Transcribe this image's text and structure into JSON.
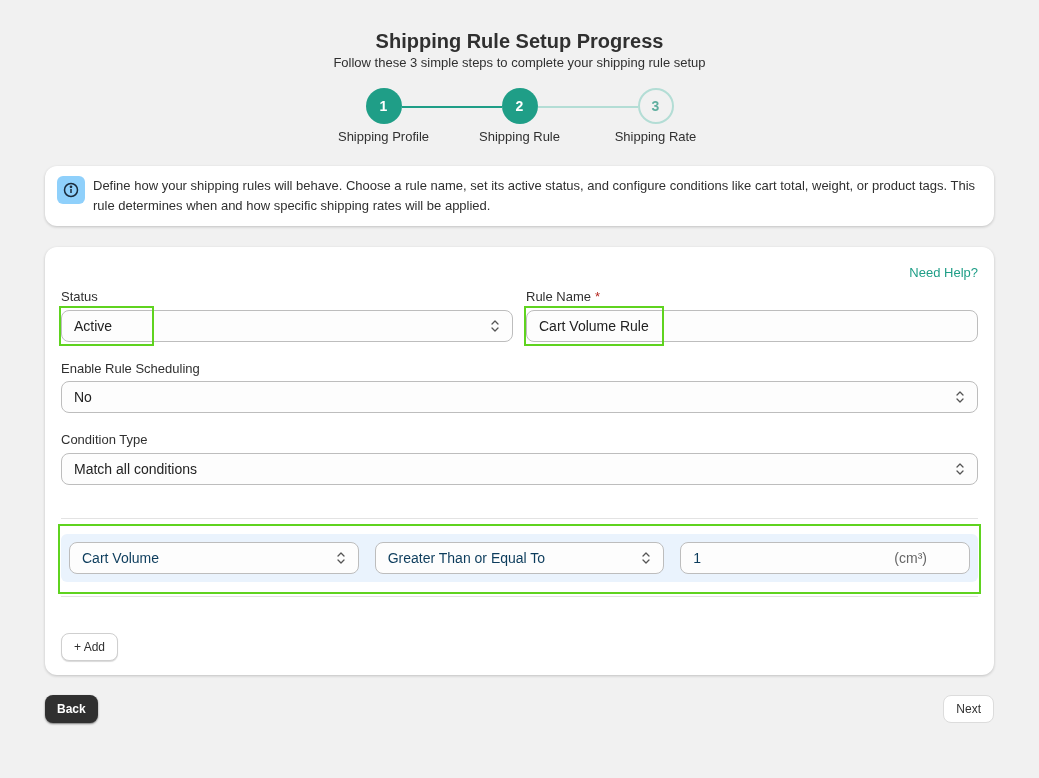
{
  "header": {
    "title": "Shipping Rule Setup Progress",
    "subtitle": "Follow these 3 simple steps to complete your shipping rule setup"
  },
  "steps": [
    {
      "number": "1",
      "label": "Shipping Profile",
      "reached": true
    },
    {
      "number": "2",
      "label": "Shipping Rule",
      "reached": true
    },
    {
      "number": "3",
      "label": "Shipping Rate",
      "reached": false
    }
  ],
  "info": {
    "text": "Define how your shipping rules will behave. Choose a rule name, set its active status, and configure conditions like cart total, weight, or product tags. This rule determines when and how specific shipping rates will be applied."
  },
  "form": {
    "help_link": "Need Help?",
    "status": {
      "label": "Status",
      "value": "Active",
      "highlighted": true
    },
    "rule_name": {
      "label": "Rule Name",
      "required_mark": "*",
      "value": "Cart Volume Rule",
      "highlighted": true
    },
    "scheduling": {
      "label": "Enable Rule Scheduling",
      "value": "No"
    },
    "condition_type": {
      "label": "Condition Type",
      "value": "Match all conditions"
    },
    "conditions": [
      {
        "highlighted": true,
        "field": "Cart Volume",
        "operator": "Greater Than or Equal To",
        "value": "1",
        "unit": "(cm³)"
      }
    ],
    "add_button": "+ Add"
  },
  "footer": {
    "back": "Back",
    "next": "Next"
  }
}
